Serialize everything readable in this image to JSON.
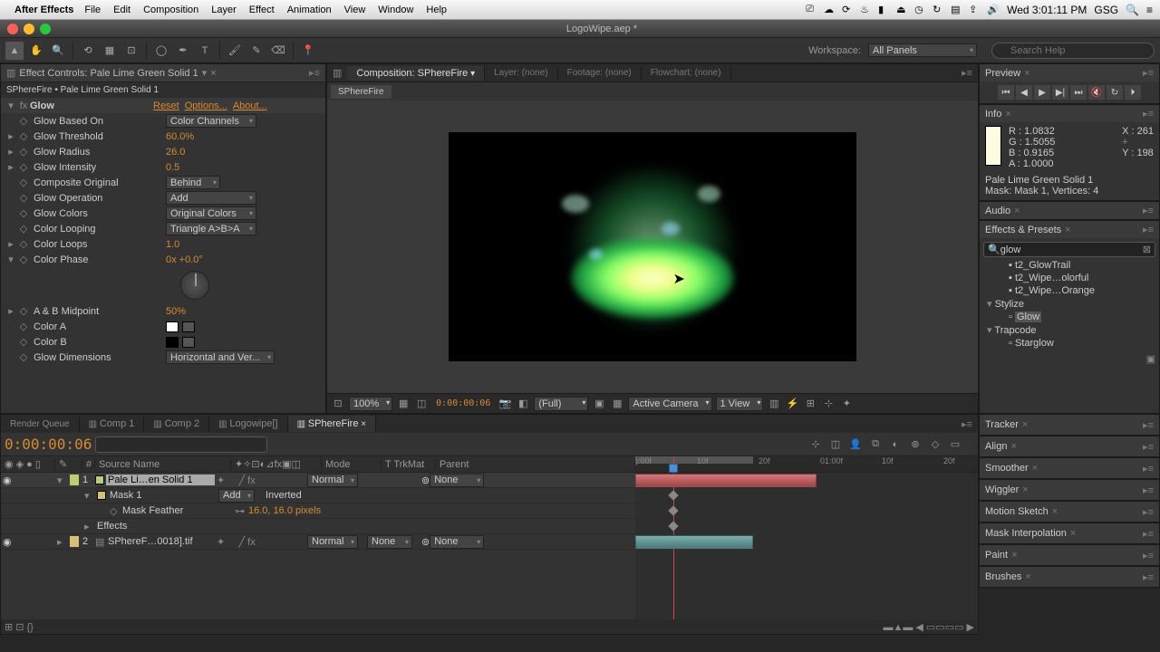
{
  "menubar": {
    "app": "After Effects",
    "menus": [
      "File",
      "Edit",
      "Composition",
      "Layer",
      "Effect",
      "Animation",
      "View",
      "Window",
      "Help"
    ],
    "clock": "Wed 3:01:11 PM",
    "user": "GSG"
  },
  "titlebar": {
    "title": "LogoWipe.aep *"
  },
  "workspace": {
    "label": "Workspace:",
    "value": "All Panels",
    "search_placeholder": "Search Help"
  },
  "effectControls": {
    "tab": "Effect Controls: Pale Lime Green Solid 1",
    "path": "SPhereFire • Pale Lime Green Solid 1",
    "effectName": "Glow",
    "reset": "Reset",
    "options": "Options...",
    "about": "About...",
    "props": {
      "glowBasedOn": {
        "label": "Glow Based On",
        "value": "Color Channels"
      },
      "glowThreshold": {
        "label": "Glow Threshold",
        "value": "60.0%"
      },
      "glowRadius": {
        "label": "Glow Radius",
        "value": "26.0"
      },
      "glowIntensity": {
        "label": "Glow Intensity",
        "value": "0.5"
      },
      "compositeOriginal": {
        "label": "Composite Original",
        "value": "Behind"
      },
      "glowOperation": {
        "label": "Glow Operation",
        "value": "Add"
      },
      "glowColors": {
        "label": "Glow Colors",
        "value": "Original Colors"
      },
      "colorLooping": {
        "label": "Color Looping",
        "value": "Triangle A>B>A"
      },
      "colorLoops": {
        "label": "Color Loops",
        "value": "1.0"
      },
      "colorPhase": {
        "label": "Color Phase",
        "value": "0x +0.0°"
      },
      "abMidpoint": {
        "label": "A & B Midpoint",
        "value": "50%"
      },
      "colorA": {
        "label": "Color A",
        "hex": "#ffffff"
      },
      "colorB": {
        "label": "Color B",
        "hex": "#000000"
      },
      "glowDimensions": {
        "label": "Glow Dimensions",
        "value": "Horizontal and Ver..."
      }
    }
  },
  "comp": {
    "tabs": {
      "composition": "Composition: SPhereFire",
      "layer": "Layer: (none)",
      "footage": "Footage: (none)",
      "flowchart": "Flowchart: (none)"
    },
    "subtab": "SPhereFire",
    "footer": {
      "zoom": "100%",
      "time": "0:00:00:06",
      "res": "(Full)",
      "camera": "Active Camera",
      "view": "1 View"
    }
  },
  "preview": {
    "label": "Preview"
  },
  "info": {
    "label": "Info",
    "r": "R : 1.0832",
    "g": "G : 1.5055",
    "b": "B : 0.9165",
    "a": "A : 1.0000",
    "x": "X : 261",
    "y": "Y : 198",
    "layer": "Pale Lime Green Solid 1",
    "mask": "Mask: Mask 1, Vertices: 4"
  },
  "audio": {
    "label": "Audio"
  },
  "effectsPresets": {
    "label": "Effects & Presets",
    "search": "glow",
    "items": [
      "t2_GlowTrail",
      "t2_Wipe…olorful",
      "t2_Wipe…Orange"
    ],
    "groups": [
      {
        "name": "Stylize",
        "items": [
          "Glow"
        ]
      },
      {
        "name": "Trapcode",
        "items": [
          "Starglow"
        ]
      }
    ]
  },
  "timeline": {
    "tabs": [
      "Render Queue",
      "Comp 1",
      "Comp 2",
      "Logowipe[]",
      "SPhereFire"
    ],
    "activeTab": "SPhereFire",
    "time": "0:00:00:06",
    "columns": {
      "num": "#",
      "source": "Source Name",
      "mode": "Mode",
      "trkmat": "T  TrkMat",
      "parent": "Parent"
    },
    "ruler": [
      "):00f",
      "10f",
      "20f",
      "01:00f",
      "10f",
      "20f"
    ],
    "layers": [
      {
        "num": "1",
        "color": "#b8d070",
        "name": "Pale Li…en Solid 1",
        "mode": "Normal",
        "trkmat": "",
        "parent": "None",
        "selected": true
      },
      {
        "num": "2",
        "color": "#d8c070",
        "name": "SPhereF…0018].tif",
        "mode": "Normal",
        "trkmat": "None",
        "parent": "None",
        "selected": false
      }
    ],
    "mask": {
      "name": "Mask 1",
      "mode": "Add",
      "inverted": "Inverted"
    },
    "maskFeather": {
      "label": "Mask Feather",
      "value": "16.0, 16.0 pixels"
    },
    "effectsLabel": "Effects"
  },
  "rightPanels": [
    "Tracker",
    "Align",
    "Smoother",
    "Wiggler",
    "Motion Sketch",
    "Mask Interpolation",
    "Paint",
    "Brushes"
  ]
}
